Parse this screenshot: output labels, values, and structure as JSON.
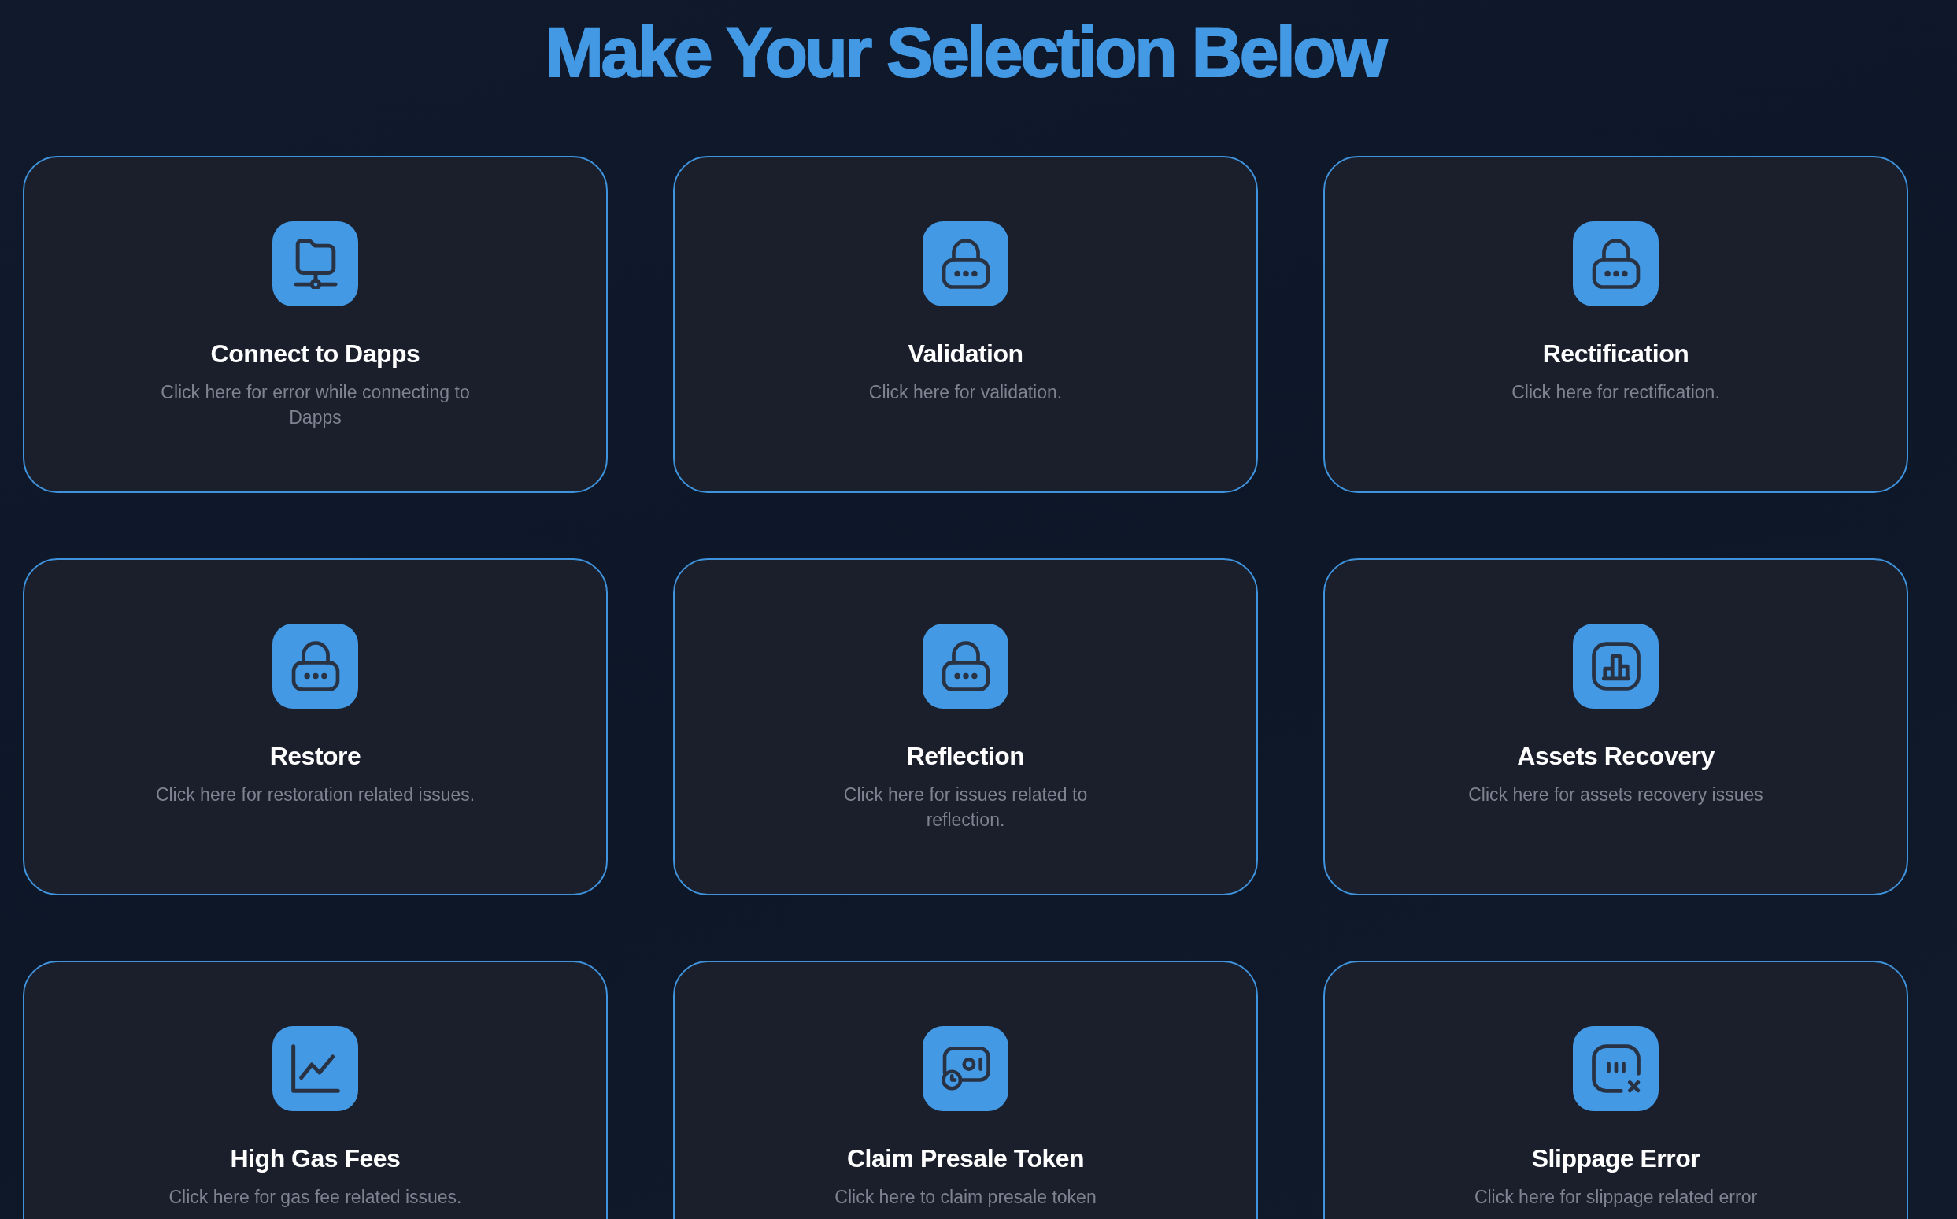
{
  "page": {
    "title": "Make Your Selection Below"
  },
  "options": [
    {
      "kind": "network",
      "title": "Connect to Dapps",
      "description": "Click here for error while connecting to Dapps"
    },
    {
      "kind": "lock",
      "title": "Validation",
      "description": "Click here for validation."
    },
    {
      "kind": "lock",
      "title": "Rectification",
      "description": "Click here for rectification."
    },
    {
      "kind": "lock",
      "title": "Restore",
      "description": "Click here for restoration related issues."
    },
    {
      "kind": "lock",
      "title": "Reflection",
      "description": "Click here for issues related to reflection."
    },
    {
      "kind": "bars",
      "title": "Assets Recovery",
      "description": "Click here for assets recovery issues"
    },
    {
      "kind": "trend",
      "title": "High Gas Fees",
      "description": "Click here for gas fee related issues."
    },
    {
      "kind": "wallet",
      "title": "Claim Presale Token",
      "description": "Click here to claim presale token"
    },
    {
      "kind": "blocked",
      "title": "Slippage Error",
      "description": "Click here for slippage related error"
    }
  ]
}
